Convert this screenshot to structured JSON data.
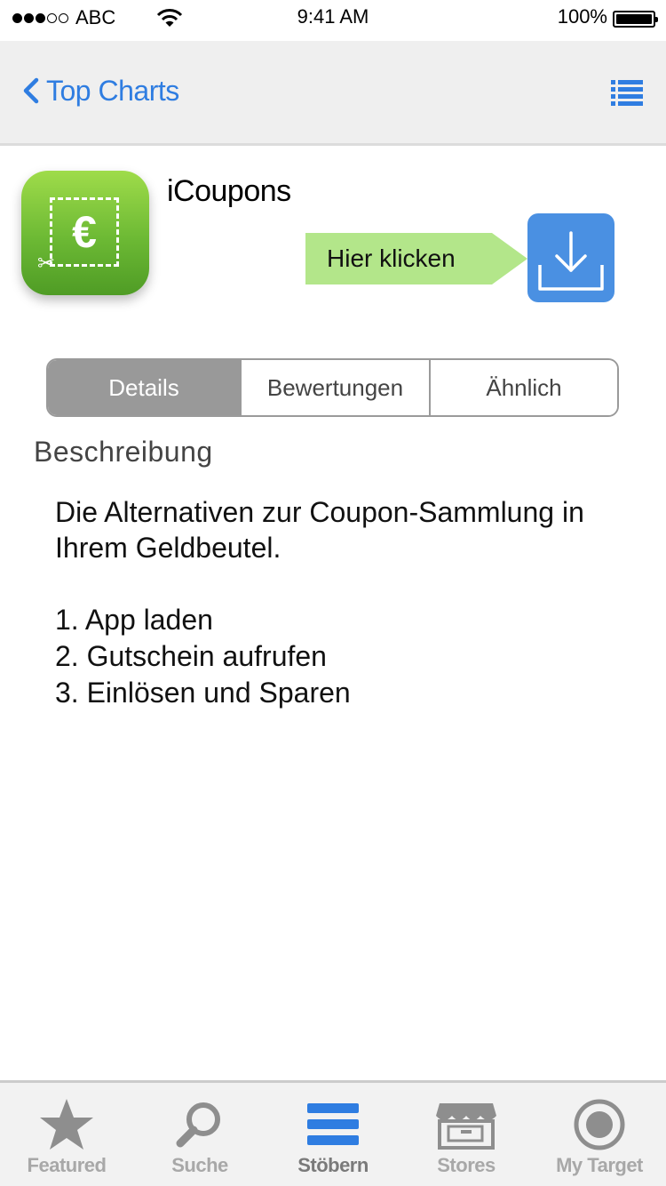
{
  "status_bar": {
    "carrier": "ABC",
    "time": "9:41 AM",
    "battery": "100%"
  },
  "nav": {
    "back_label": "Top Charts",
    "accent_color": "#2f7de1",
    "right_icon": "list-icon"
  },
  "app": {
    "name": "iCoupons",
    "icon": "coupon-euro-icon",
    "icon_symbol": "€",
    "hint_label": "Hier klicken",
    "hint_color": "#b3e68a",
    "download_color": "#4a90e2"
  },
  "segments": [
    {
      "label": "Details",
      "active": true
    },
    {
      "label": "Bewertungen",
      "active": false
    },
    {
      "label": "Ähnlich",
      "active": false
    }
  ],
  "description": {
    "title": "Beschreibung",
    "text": "Die Alternativen zur Coupon-Sammlung in Ihrem Geldbeutel.",
    "steps": [
      "1. App laden",
      "2. Gutschein aufrufen",
      "3. Einlösen und Sparen"
    ]
  },
  "tab_bar": {
    "items": [
      {
        "label": "Featured",
        "icon": "star-icon"
      },
      {
        "label": "Suche",
        "icon": "search-icon"
      },
      {
        "label": "Stöbern",
        "icon": "list-icon",
        "active": true
      },
      {
        "label": "Stores",
        "icon": "store-icon"
      },
      {
        "label": "My Target",
        "icon": "target-icon"
      }
    ]
  }
}
